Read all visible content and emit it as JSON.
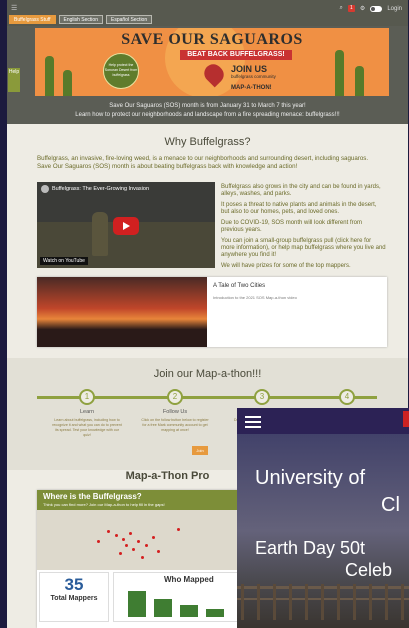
{
  "nav": {
    "tabs": [
      "Buffelgrass Stuff",
      "English Section",
      "Español Section"
    ],
    "badge": "1",
    "user": "Login"
  },
  "banner": {
    "title": "SAVE OUR SAGUAROS",
    "ribbon": "BEAT BACK BUFFELGRASS!",
    "seal": "Help protect the Sonoran Desert from buffelgrass",
    "join": "JOIN US",
    "sub": "buffelgrass community",
    "map": "MAP-A-THON!",
    "side_tab": "Help"
  },
  "intro": {
    "line1": "Save Our Saguaros (SOS) month is from January 31 to March 7 this year!",
    "line2": "Learn how to protect our neighborhoods and landscape from a fire spreading menace: buffelgrass!!!"
  },
  "why": {
    "heading": "Why Buffelgrass?",
    "para": "Buffelgrass, an invasive, fire-loving weed, is a menace to our neighborhoods and surrounding desert, including saguaros. Save Our Saguaros (SOS) month is about beating buffelgrass back with knowledge and action!",
    "video_title": "Buffelgrass: The Ever-Growing Invasion",
    "video_watch": "Watch on YouTube",
    "right": [
      "Buffelgrass also grows in the city and can be found in yards, alleys, washes, and parks.",
      "It poses a threat to native plants and animals in the desert, but also to our homes, pets, and loved ones.",
      "Due to COVID-19, SOS month will look different from previous years.",
      "You can join a small-group buffelgrass pull (click here for more information), or help map buffelgrass where you live and anywhere you find it!",
      "We will have prizes for some of the top mappers."
    ],
    "card_title": "A Tale of Two Cities",
    "card_sub": "Introduction to the 2021 SOS Map-a-thon video"
  },
  "mapathon": {
    "heading": "Join our Map-a-thon!!!",
    "steps": [
      {
        "num": "1",
        "label": "Learn",
        "text": "Learn about buffelgrass, including how to recognize it and what you can do to prevent its spread. Test your knowledge with our quiz!"
      },
      {
        "num": "2",
        "label": "Follow Us",
        "text": "Click on the follow button below to register for a free Mark community account to get mapping at once!"
      },
      {
        "num": "3",
        "label": "Do",
        "text": "Download the app and start to map"
      },
      {
        "num": "4",
        "label": "",
        "text": ""
      }
    ],
    "button": "Join"
  },
  "dashboard": {
    "heading": "Map-a-Thon Pro",
    "title": "Where is the Buffelgrass?",
    "sub": "Think you can find more? Join our Map-a-thon to help fill in the gaps!",
    "total": "35",
    "total_label": "Total Mappers",
    "who_title": "Who Mapped"
  },
  "overlay": {
    "title_line1": "University of",
    "title_line2": "Cl",
    "sub_line1": "Earth Day 50t",
    "sub_line2": "Celeb"
  }
}
